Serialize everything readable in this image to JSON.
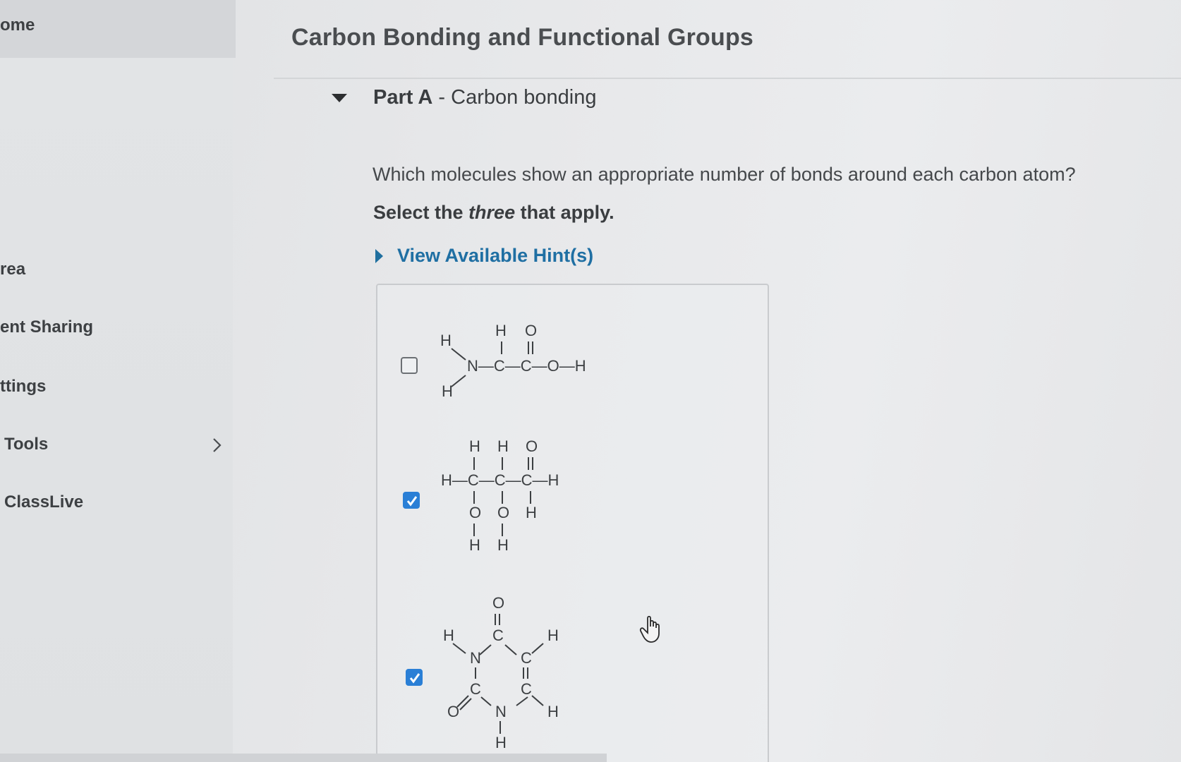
{
  "sidebar": {
    "items": [
      {
        "label": "ome"
      },
      {
        "label": "rea"
      },
      {
        "label": "ent Sharing"
      },
      {
        "label": "ttings"
      },
      {
        "label": "Tools"
      },
      {
        "label": "ClassLive"
      }
    ]
  },
  "header": {
    "title": "Carbon Bonding and Functional Groups"
  },
  "part": {
    "label": "Part A",
    "separator": " - ",
    "name": "Carbon bonding"
  },
  "question": {
    "text": "Which molecules show an appropriate number of bonds around each carbon atom?",
    "instruction_pre": "Select the ",
    "instruction_em": "three",
    "instruction_post": " that apply.",
    "hint_link": "View Available Hint(s)"
  },
  "options": [
    {
      "checked": false,
      "atoms": [
        "H",
        "H",
        "O",
        "N—C—C—O—H",
        "H"
      ]
    },
    {
      "checked": true,
      "atoms": [
        "H",
        "H",
        "O",
        "H—C—C—C—H",
        "O",
        "O",
        "H",
        "H",
        "H"
      ]
    },
    {
      "checked": true,
      "atoms": [
        "O",
        "C",
        "H",
        "H",
        "N",
        "C",
        "C",
        "C",
        "O",
        "N",
        "H",
        "H"
      ]
    }
  ],
  "colors": {
    "accent": "#1f6fa3",
    "checkbox_checked": "#2a7fd6"
  }
}
